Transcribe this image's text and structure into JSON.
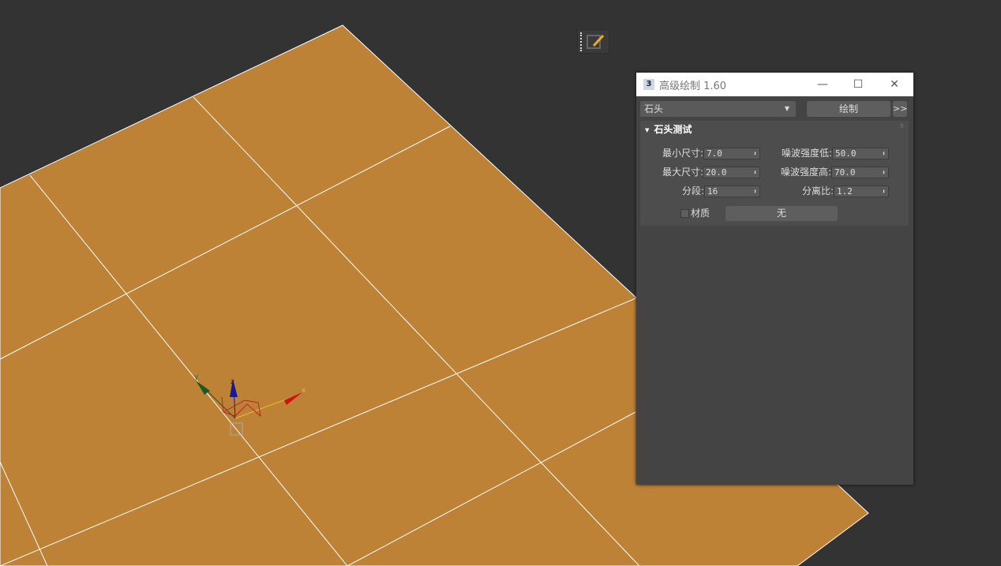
{
  "colors": {
    "plane": "#be8236",
    "grid": "#ffffff",
    "background": "#333333",
    "panel": "#444444"
  },
  "viewport": {
    "axis_labels": {
      "x": "x",
      "y": "y",
      "z": "z"
    }
  },
  "toolbar_button": {
    "icon": "pencil-edit-icon"
  },
  "dialog": {
    "title": "高级绘制 1.60",
    "title_icon_text": "3",
    "minimize": "—",
    "maximize": "☐",
    "close": "✕",
    "type_dropdown": "石头",
    "draw_button": "绘制",
    "expand_button": ">>",
    "rollout": {
      "title": "石头测试",
      "fields": [
        {
          "label": "最小尺寸:",
          "value": "7.0"
        },
        {
          "label": "最大尺寸:",
          "value": "20.0"
        },
        {
          "label": "分段:",
          "value": "16"
        },
        {
          "label": "噪波强度低:",
          "value": "50.0"
        },
        {
          "label": "噪波强度高:",
          "value": "70.0"
        },
        {
          "label": "分离比:",
          "value": "1.2"
        }
      ],
      "material_label": "材质",
      "material_button": "无"
    }
  }
}
